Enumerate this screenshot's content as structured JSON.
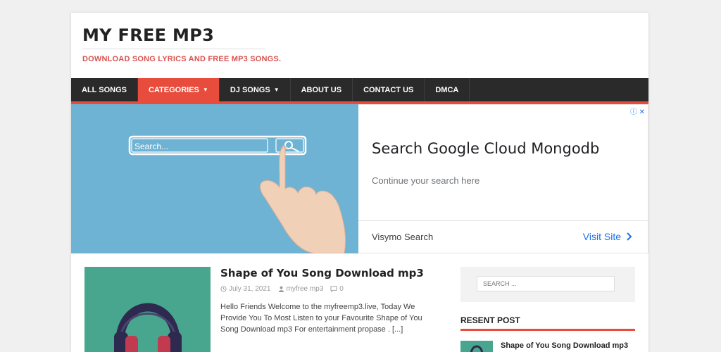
{
  "site": {
    "title": "MY FREE MP3",
    "tagline": "DOWNLOAD SONG LYRICS AND FREE MP3 SONGS."
  },
  "nav": {
    "items": [
      {
        "label": "ALL SONGS"
      },
      {
        "label": "CATEGORIES"
      },
      {
        "label": "DJ SONGS"
      },
      {
        "label": "ABOUT US"
      },
      {
        "label": "CONTACT US"
      },
      {
        "label": "DMCA"
      }
    ]
  },
  "ad": {
    "search_placeholder": "Search...",
    "headline": "Search Google Cloud Mongodb",
    "sub": "Continue your search here",
    "advertiser": "Visymo Search",
    "cta": "Visit Site"
  },
  "post": {
    "title": "Shape of You Song Download mp3",
    "date": "July 31, 2021",
    "author": "myfree mp3",
    "comments": "0",
    "excerpt": "Hello Friends Welcome to the myfreemp3.live, Today We Provide You To Most Listen to your Favourite Shape of You Song Download mp3 For entertainment propase . [...]"
  },
  "sidebar": {
    "search_placeholder": "SEARCH ...",
    "recent_title": "RESENT POST",
    "recent_items": [
      {
        "label": "Shape of You Song Download mp3"
      }
    ]
  },
  "colors": {
    "accent": "#e74c3c",
    "nav_bg": "#2a2a2a",
    "link_blue": "#1a73e8"
  }
}
